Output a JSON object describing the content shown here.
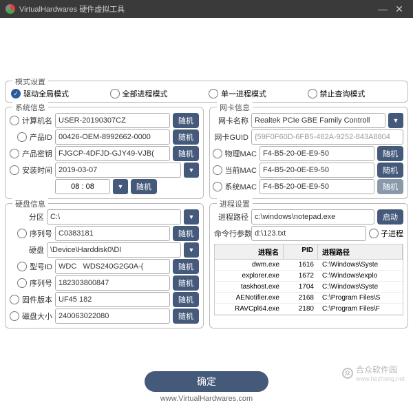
{
  "title": "VirtualHardwares 硬件虚拟工具",
  "mode_group": "模式设置",
  "modes": [
    "驱动全局模式",
    "全部进程模式",
    "单一进程模式",
    "禁止查询模式"
  ],
  "sys_group": "系统信息",
  "sys": {
    "computer_label": "计算机名",
    "computer": "USER-20190307CZ",
    "product_id_label": "产品ID",
    "product_id": "00426-OEM-8992662-0000",
    "product_key_label": "产品密钥",
    "product_key": "FJGCP-4DFJD-GJY49-VJB(",
    "install_time_label": "安装时间",
    "install_date": "2019-03-07",
    "install_time": "08 : 08"
  },
  "disk_group": "硬盘信息",
  "disk": {
    "partition_label": "分区",
    "partition": "C:\\",
    "serial_label": "序列号",
    "serial": "C0383181",
    "disk_label": "硬盘",
    "disk_path": "\\Device\\Harddisk0\\DI",
    "model_label": "型号ID",
    "model": "WDC   WDS240G2G0A-(",
    "serial2_label": "序列号",
    "serial2": "182303800847",
    "firmware_label": "固件版本",
    "firmware": "UF45 182",
    "size_label": "磁盘大小",
    "size": "240063022080"
  },
  "nic_group": "网卡信息",
  "nic": {
    "name_label": "网卡名称",
    "name": "Realtek PCIe GBE Family Controll",
    "guid_label": "网卡GUID",
    "guid": "{59F0F60D-6FB5-462A-9252-843A8804",
    "phys_mac_label": "物理MAC",
    "phys_mac": "F4-B5-20-0E-E9-50",
    "curr_mac_label": "当前MAC",
    "curr_mac": "F4-B5-20-0E-E9-50",
    "sys_mac_label": "系统MAC",
    "sys_mac": "F4-B5-20-0E-E9-50"
  },
  "proc_group": "进程设置",
  "proc": {
    "path_label": "进程路径",
    "path": "c:\\windows\\notepad.exe",
    "args_label": "命令行参数",
    "args": "d:\\123.txt",
    "child_label": "子进程"
  },
  "table": {
    "h_name": "进程名",
    "h_pid": "PID",
    "h_path": "进程路径",
    "rows": [
      {
        "name": "dwm.exe",
        "pid": "1616",
        "path": "C:\\Windows\\Syste"
      },
      {
        "name": "explorer.exe",
        "pid": "1672",
        "path": "C:\\Windows\\explo"
      },
      {
        "name": "taskhost.exe",
        "pid": "1704",
        "path": "C:\\Windows\\Syste"
      },
      {
        "name": "AENotifier.exe",
        "pid": "2168",
        "path": "C:\\Program Files\\S"
      },
      {
        "name": "RAVCpl64.exe",
        "pid": "2180",
        "path": "C:\\Program Files\\F"
      }
    ]
  },
  "btn_random": "随机",
  "btn_launch": "启动",
  "btn_confirm": "确定",
  "footer": "www.VirtualHardwares.com",
  "watermark": "合众软件园",
  "watermark_url": "www.hezhong.net"
}
